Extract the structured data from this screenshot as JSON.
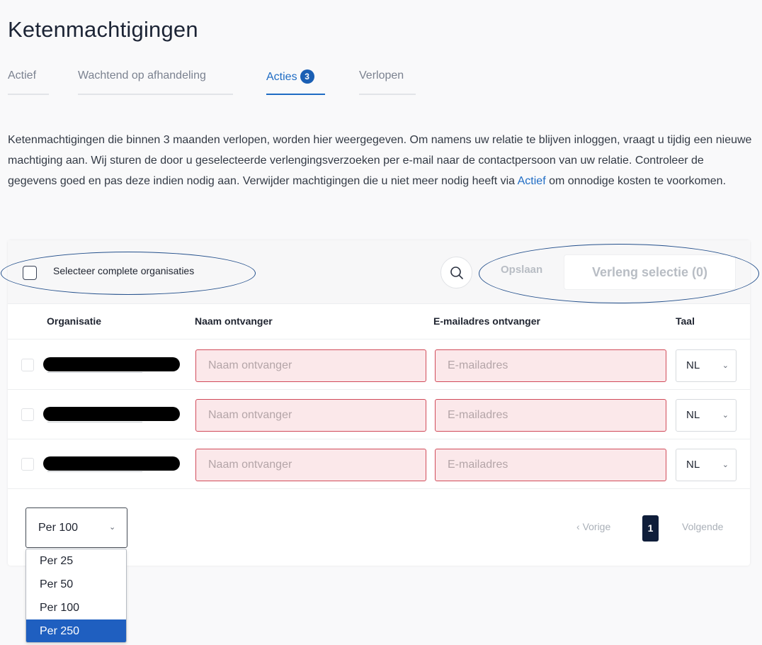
{
  "page": {
    "title": "Ketenmachtigingen"
  },
  "tabs": [
    {
      "label": "Actief"
    },
    {
      "label": "Wachtend op afhandeling"
    },
    {
      "label": "Acties",
      "badge": "3"
    },
    {
      "label": "Verlopen"
    }
  ],
  "intro": {
    "text_before_link": "Ketenmachtigingen die binnen 3 maanden verlopen, worden hier weergegeven. Om namens uw relatie te blijven inloggen, vraagt u tijdig een nieuwe machtiging aan. Wij sturen de door u geselecteerde verlengingsverzoeken per e-mail naar de contactpersoon van uw relatie. Controleer de gegevens goed en pas deze indien nodig aan. Verwijder machtigingen die u niet meer nodig heeft via ",
    "link_label": "Actief",
    "text_after_link": " om onnodige kosten te voorkomen."
  },
  "toolbar": {
    "select_all_label": "Selecteer complete organisaties",
    "save_label": "Opslaan",
    "extend_label": "Verleng selectie (0)"
  },
  "table": {
    "headers": {
      "organisation": "Organisatie",
      "recipient_name": "Naam ontvanger",
      "recipient_email": "E-mailadres ontvanger",
      "language": "Taal"
    },
    "rows": [
      {
        "name_placeholder": "Naam ontvanger",
        "email_placeholder": "E-mailadres",
        "language": "NL"
      },
      {
        "name_placeholder": "Naam ontvanger",
        "email_placeholder": "E-mailadres",
        "language": "NL"
      },
      {
        "name_placeholder": "Naam ontvanger",
        "email_placeholder": "E-mailadres",
        "language": "NL"
      }
    ]
  },
  "pagination": {
    "per_page_value": "Per 100",
    "per_page_options": [
      "Per 25",
      "Per 50",
      "Per 100",
      "Per 250"
    ],
    "highlighted_option": "Per 250",
    "prev_label": "Vorige",
    "current_page": "1",
    "next_label": "Volgende"
  },
  "colors": {
    "accent": "#1f6cc4",
    "error_border": "#d14b5a",
    "error_fill": "#fbe8ea",
    "page_active": "#0f1e3a",
    "option_selected": "#1f5fc0"
  },
  "icons": {
    "search": "search-icon",
    "chevron": "chevron-down-icon",
    "prev": "chevron-left-icon"
  }
}
